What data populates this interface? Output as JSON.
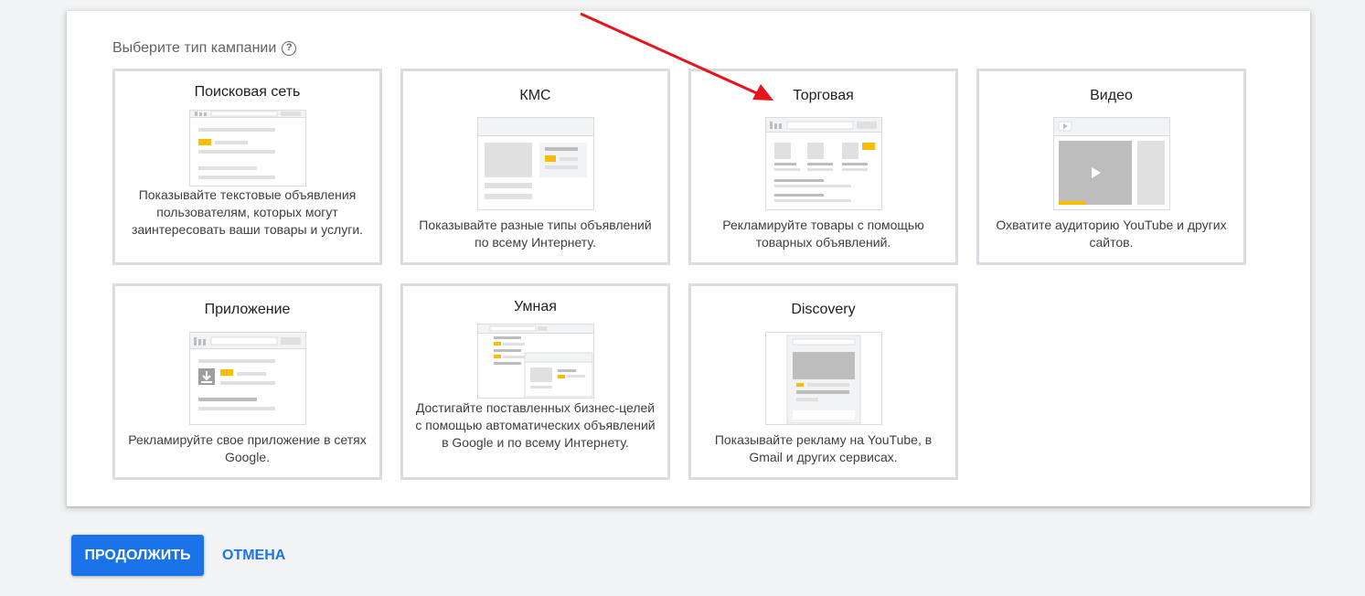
{
  "heading": {
    "text": "Выберите тип кампании",
    "help_icon": "?"
  },
  "cards": [
    {
      "title": "Поисковая сеть",
      "desc": "Показывайте текстовые объявления пользователям, которых могут заинтересовать ваши товары и услуги."
    },
    {
      "title": "КМС",
      "desc": "Показывайте разные типы объявлений по всему Интернету."
    },
    {
      "title": "Торговая",
      "desc": "Рекламируйте товары с помощью товарных объявлений."
    },
    {
      "title": "Видео",
      "desc": "Охватите аудиторию YouTube и других сайтов."
    },
    {
      "title": "Приложение",
      "desc": "Рекламируйте свое приложение в сетях Google."
    },
    {
      "title": "Умная",
      "desc": "Достигайте поставленных бизнес-целей с помощью автоматических объявлений в Google и по всему Интернету."
    },
    {
      "title": "Discovery",
      "desc": "Показывайте рекламу на YouTube, в Gmail и других сервисах."
    }
  ],
  "actions": {
    "continue_label": "ПРОДОЛЖИТЬ",
    "cancel_label": "ОТМЕНА"
  },
  "colors": {
    "accent": "#1a73e8",
    "highlight": "#fbbc04",
    "annotation_arrow": "#e8141c"
  }
}
